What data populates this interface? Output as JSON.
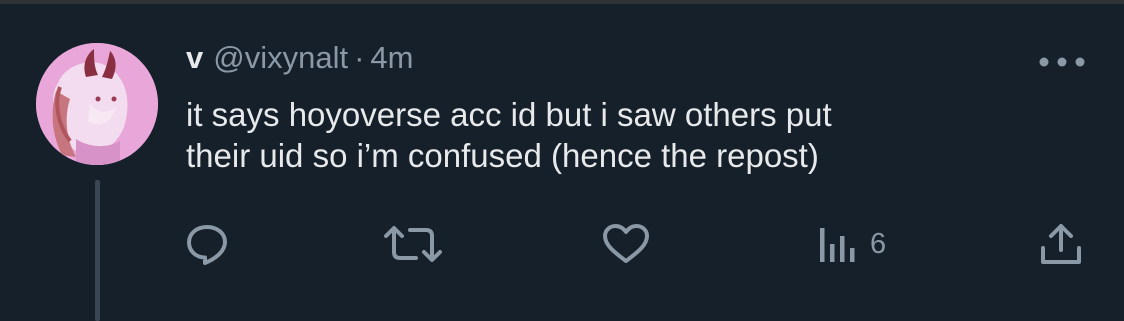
{
  "tweet": {
    "display_name": "v",
    "handle": "@vixynalt",
    "separator": "·",
    "timestamp": "4m",
    "text_line1": "it says hoyoverse acc id but i saw others put",
    "text_line2": "their uid so i’m confused (hence the repost)",
    "avatar_icon": "anime-character-avatar"
  },
  "actions": {
    "reply_icon": "reply-icon",
    "retweet_icon": "retweet-icon",
    "like_icon": "heart-icon",
    "views_icon": "views-chart-icon",
    "views_count": "6",
    "share_icon": "share-icon",
    "more_icon": "more-dots-icon"
  },
  "colors": {
    "background": "#15202b",
    "primary_text": "#e7e9ea",
    "secondary_text": "#8b98a5",
    "avatar_bg": "#e8a7d9"
  }
}
